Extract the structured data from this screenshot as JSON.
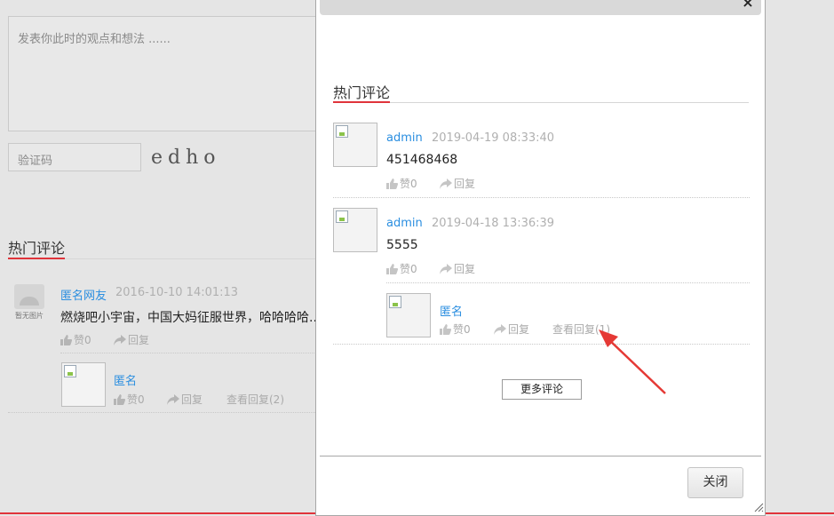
{
  "background": {
    "textarea_placeholder": "发表你此时的观点和想法 ......",
    "captcha_placeholder": "验证码",
    "captcha_text": "edho",
    "section_title": "热门评论",
    "comment": {
      "avatar_caption": "暂无图片",
      "user": "匿名网友",
      "time": "2016-10-10 14:01:13",
      "text": "燃烧吧小宇宙，中国大妈征服世界，哈哈哈哈...",
      "like": "赞0",
      "reply": "回复",
      "sub_reply": {
        "user": "匿名",
        "like": "赞0",
        "reply": "回复",
        "view_replies": "查看回复(2)"
      }
    }
  },
  "modal": {
    "close_symbol": "×",
    "section_title": "热门评论",
    "comments": [
      {
        "user": "admin",
        "time": "2019-04-19 08:33:40",
        "text": "451468468",
        "like": "赞0",
        "reply": "回复"
      },
      {
        "user": "admin",
        "time": "2019-04-18 13:36:39",
        "text": "5555",
        "like": "赞0",
        "reply": "回复"
      }
    ],
    "sub_reply": {
      "user": "匿名",
      "like": "赞0",
      "reply": "回复",
      "view_replies": "查看回复(1)"
    },
    "more_button": "更多评论",
    "close_button": "关闭"
  },
  "colors": {
    "accent_red": "#e0343b",
    "link_blue": "#2a8ee0"
  }
}
